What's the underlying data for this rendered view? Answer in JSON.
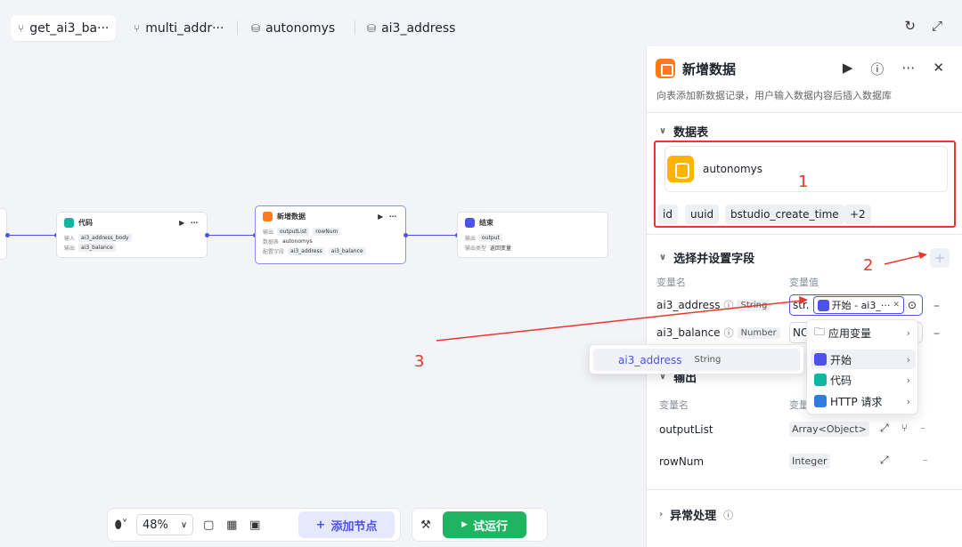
{
  "tabs": [
    {
      "icon": "workflow-icon",
      "label": "get_ai3_ba···"
    },
    {
      "icon": "workflow-icon",
      "label": "multi_addr···"
    },
    {
      "icon": "database-icon",
      "label": "autonomys"
    },
    {
      "icon": "database-icon",
      "label": "ai3_address"
    }
  ],
  "canvas": {
    "nodes": {
      "code": {
        "title": "代码",
        "in_label": "输入",
        "in_value": "ai3_address_body",
        "out_label": "输出",
        "out_value": "ai3_balance"
      },
      "add": {
        "title": "新增数据",
        "out_label": "输出",
        "out_values": [
          "outputList",
          "rowNum"
        ],
        "db_label": "数据表",
        "db_value": "autonomys",
        "field_label": "配置字段",
        "field_values": [
          "ai3_address",
          "ai3_balance"
        ]
      },
      "end": {
        "title": "结束",
        "out_label": "输出",
        "out_value": "output",
        "type_label": "输出类型",
        "type_value": "返回变量"
      }
    },
    "annotation_3": "3"
  },
  "toolbar": {
    "zoom": "48%",
    "add_node": "添加节点",
    "run": "试运行"
  },
  "panel": {
    "title": "新增数据",
    "description": "向表添加新数据记录，用户输入数据内容后插入数据库",
    "table_section": "数据表",
    "table_name": "autonomys",
    "table_fields": [
      "id",
      "uuid",
      "bstudio_create_time",
      "+2"
    ],
    "annotation_1": "1",
    "fields_section": "选择并设置字段",
    "annotation_2": "2",
    "col_name": "变量名",
    "col_value": "变量值",
    "fields": [
      {
        "name": "ai3_address",
        "type": "String",
        "prefix": "str.",
        "ref": "开始 - ai3_···"
      },
      {
        "name": "ai3_balance",
        "type": "Number",
        "prefix": "NO"
      }
    ],
    "output_section": "输出",
    "out_col_name": "变量名",
    "out_col_type": "变量",
    "outputs": [
      {
        "name": "outputList",
        "type": "Array<Object>"
      },
      {
        "name": "rowNum",
        "type": "Integer"
      }
    ],
    "error_section": "异常处理"
  },
  "dropdown": {
    "items": [
      "应用变量",
      "开始",
      "代码",
      "HTTP 请求"
    ]
  },
  "submenu": {
    "name": "ai3_address",
    "type": "String"
  },
  "colors": {
    "accent": "#4d53e8",
    "annotation": "#e8372b",
    "run": "#1fb462"
  }
}
